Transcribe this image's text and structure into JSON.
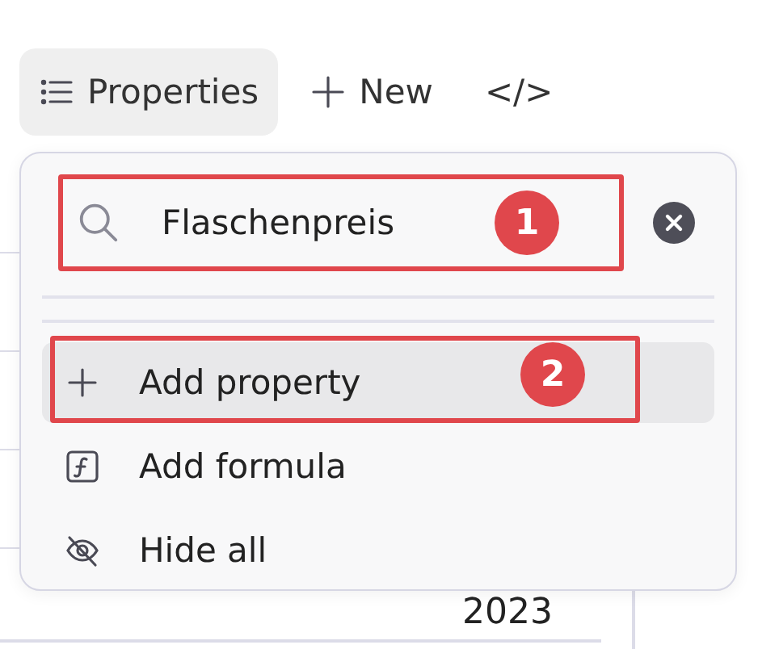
{
  "toolbar": {
    "buttons": [
      {
        "kind": "properties",
        "label": "Properties",
        "selected": true
      },
      {
        "kind": "new",
        "label": "New",
        "selected": false
      },
      {
        "kind": "code",
        "label": "</>",
        "selected": false
      }
    ]
  },
  "table": {
    "cell": "2023"
  },
  "popup": {
    "search": {
      "value": "Flaschenpreis",
      "annotation": "1"
    },
    "items": [
      {
        "kind": "add",
        "label": "Add property",
        "highlighted": true,
        "annotation": "2"
      },
      {
        "kind": "formula",
        "label": "Add formula",
        "highlighted": false
      },
      {
        "kind": "hide",
        "label": "Hide all",
        "highlighted": false
      }
    ]
  }
}
